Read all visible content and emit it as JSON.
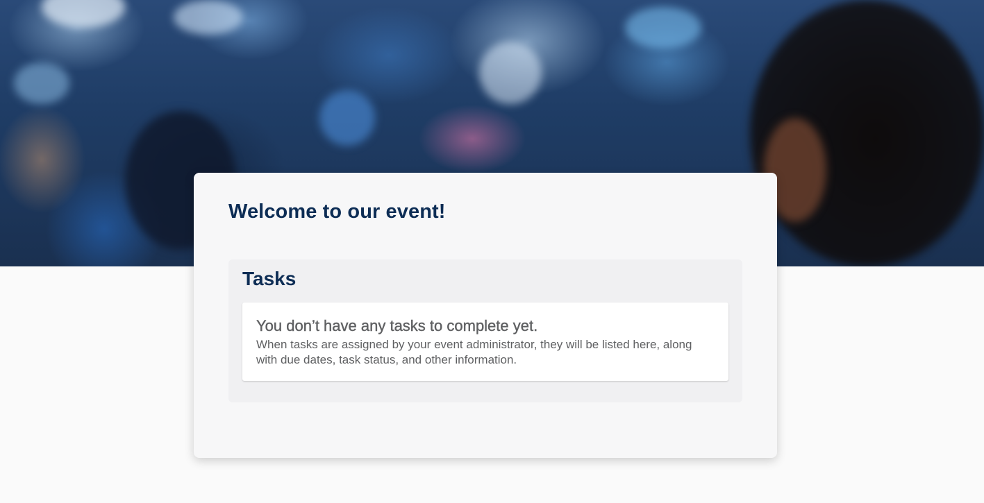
{
  "hero": {
    "image_description_icon": "crowd-photo"
  },
  "welcome": {
    "title": "Welcome to our event!"
  },
  "tasks": {
    "heading": "Tasks",
    "empty_state": {
      "title": "You don’t have any tasks to complete yet.",
      "description": "When tasks are assigned by your event administrator, they will be listed here, along with due dates, task status, and other information."
    }
  },
  "colors": {
    "heading": "#0d2d55",
    "body_text": "#5f6062",
    "page_background": "#fafafa",
    "card_background": "#f7f7f8",
    "panel_background": "#f0f0f2"
  }
}
